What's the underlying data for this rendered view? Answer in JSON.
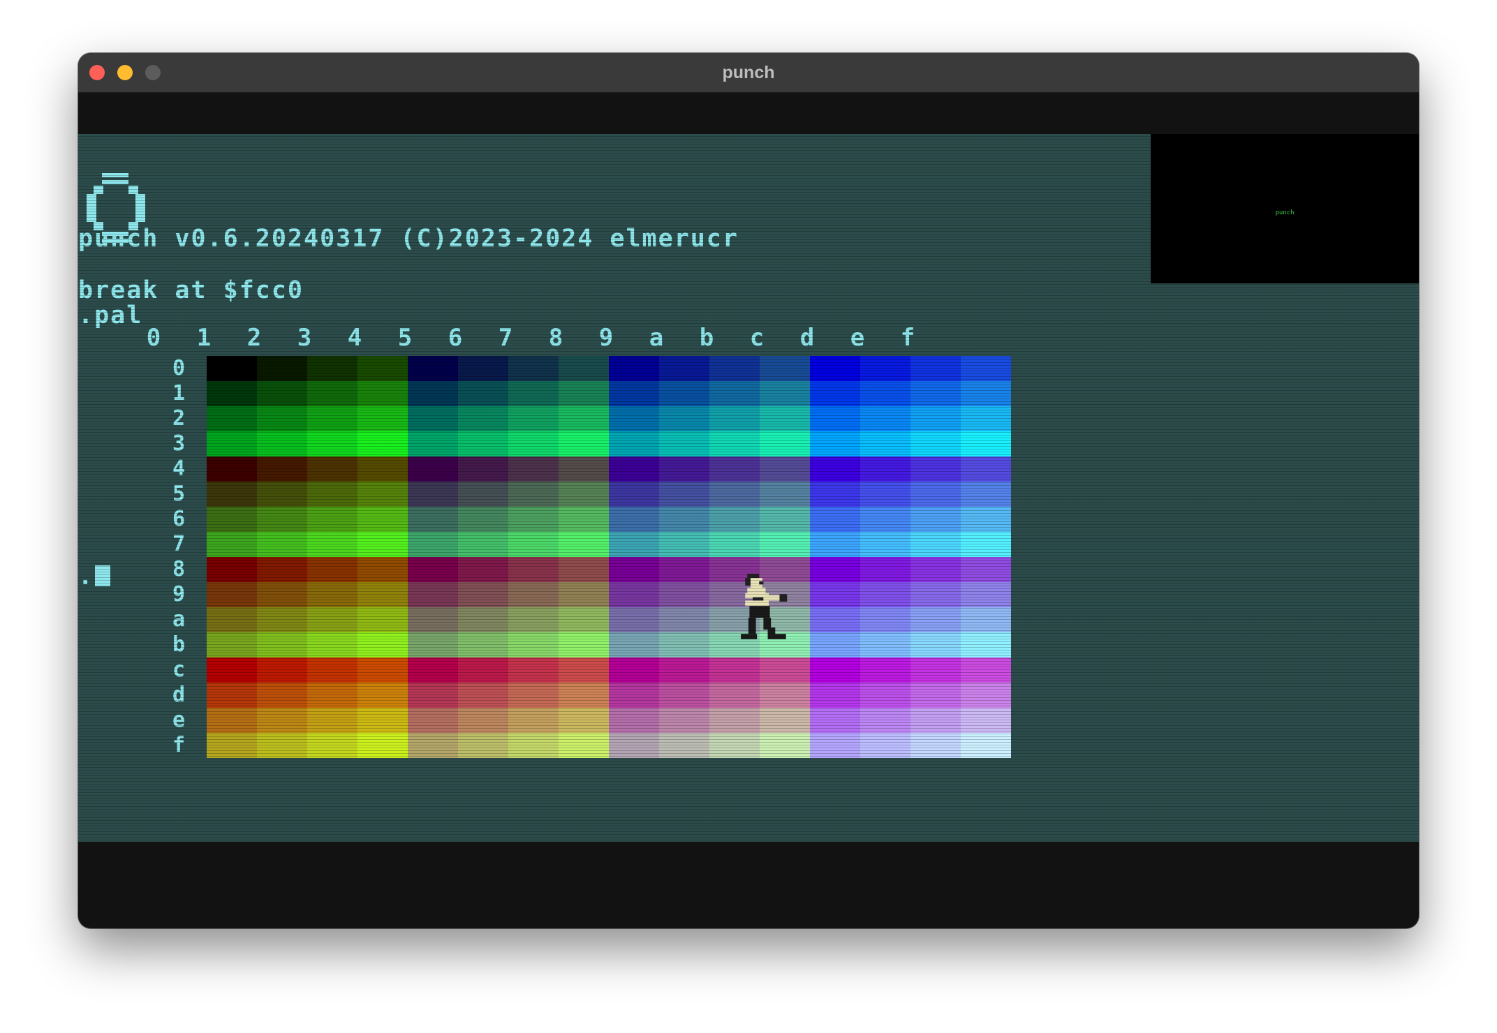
{
  "window": {
    "title": "punch"
  },
  "preview": {
    "label": "punch"
  },
  "terminal": {
    "version_line": "punch v0.6.20240317 (C)2023-2024 elmerucr",
    "break_line": "break at $fcc0",
    "command_line": ".pal",
    "prompt": "."
  },
  "palette": {
    "column_headers": [
      "0",
      "1",
      "2",
      "3",
      "4",
      "5",
      "6",
      "7",
      "8",
      "9",
      "a",
      "b",
      "c",
      "d",
      "e",
      "f"
    ],
    "row_headers": [
      "0",
      "1",
      "2",
      "3",
      "4",
      "5",
      "6",
      "7",
      "8",
      "9",
      "a",
      "b",
      "c",
      "d",
      "e",
      "f"
    ]
  },
  "icons": {
    "logo": "punch-logo-icon",
    "sprite": "boxer-sprite-icon"
  },
  "colors": {
    "screen_bg": "#2c4c4b",
    "text": "#8ee7ec",
    "close": "#fe5f57",
    "minimize": "#febc2e",
    "maximize": "#5c5c5c"
  }
}
